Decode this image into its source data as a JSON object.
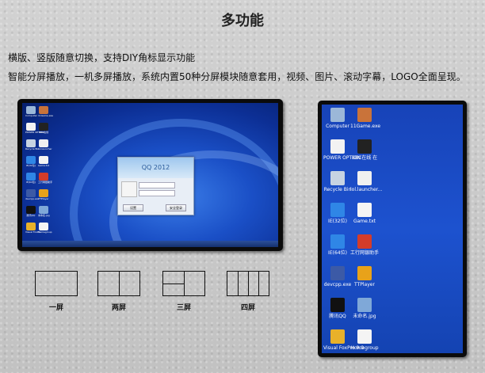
{
  "title": "多功能",
  "line1": "横版、竖版随意切换，支持DIY角标显示功能",
  "line2": "智能分屏播放，一机多屏播放，系统内置50种分屏模块随意套用，视频、图片、滚动字幕，LOGO全面呈现。",
  "horizontal_desktop": {
    "icons": [
      {
        "name": "computer-icon",
        "label": "Computer",
        "color": "#9bb7d8"
      },
      {
        "name": "game-icon",
        "label": "11Game.exe",
        "color": "#c9733a"
      },
      {
        "name": "power-icon",
        "label": "POWER OPTION",
        "color": "#f2f2f2"
      },
      {
        "name": "bbc-icon",
        "label": "BBC在线",
        "color": "#222"
      },
      {
        "name": "recycle-icon",
        "label": "Recycle Bin",
        "color": "#c7d3e2"
      },
      {
        "name": "lol-icon",
        "label": "lol.launcher",
        "color": "#f0f0f0"
      },
      {
        "name": "ie-icon",
        "label": "IE(32位)",
        "color": "#2f86e6"
      },
      {
        "name": "file-icon",
        "label": "Game.txt",
        "color": "#f4f4f4"
      },
      {
        "name": "ie64-icon",
        "label": "IE(64位)",
        "color": "#2f86e6"
      },
      {
        "name": "bank-icon",
        "label": "工行网银助手",
        "color": "#d43c2a"
      },
      {
        "name": "dev-icon",
        "label": "devcpp.exe",
        "color": "#3c5aa6"
      },
      {
        "name": "player-icon",
        "label": "TTPlayer",
        "color": "#e8a21a"
      },
      {
        "name": "qq-icon",
        "label": "腾讯QQ",
        "color": "#111"
      },
      {
        "name": "image-icon",
        "label": "未命名.jpg",
        "color": "#7fa8d8"
      },
      {
        "name": "foxpro-icon",
        "label": "Visual FoxPro",
        "color": "#e8b12a"
      },
      {
        "name": "homegroup-icon",
        "label": "Homegroup",
        "color": "#f4f4f4"
      }
    ],
    "qq_window": {
      "title": "QQ 2012",
      "login_button": "安全登录",
      "settings_button": "设置"
    }
  },
  "vertical_desktop": {
    "icons": [
      {
        "name": "computer-icon",
        "label": "Computer",
        "color": "#9bb7d8"
      },
      {
        "name": "game-icon",
        "label": "11Game.exe",
        "color": "#c9733a"
      },
      {
        "name": "power-icon",
        "label": "POWER OPTION",
        "color": "#f2f2f2"
      },
      {
        "name": "bbc-icon",
        "label": "BBC在线 在",
        "color": "#222"
      },
      {
        "name": "recycle-icon",
        "label": "Recycle Bin",
        "color": "#c7d3e2"
      },
      {
        "name": "lol-icon",
        "label": "lol.launcher...",
        "color": "#f0f0f0"
      },
      {
        "name": "ie-icon",
        "label": "IE(32位)",
        "color": "#2f86e6"
      },
      {
        "name": "file-icon",
        "label": "Game.txt",
        "color": "#f4f4f4"
      },
      {
        "name": "ie64-icon",
        "label": "IE(64位)",
        "color": "#2f86e6"
      },
      {
        "name": "bank-icon",
        "label": "工行网银助手",
        "color": "#d43c2a"
      },
      {
        "name": "dev-icon",
        "label": "devcpp.exe",
        "color": "#3c5aa6"
      },
      {
        "name": "player-icon",
        "label": "TTPlayer",
        "color": "#e8a21a"
      },
      {
        "name": "qq-icon",
        "label": "腾讯QQ",
        "color": "#111"
      },
      {
        "name": "image-icon",
        "label": "未命名.jpg",
        "color": "#7fa8d8"
      },
      {
        "name": "foxpro-icon",
        "label": "Visual FoxPro 9.0",
        "color": "#e8b12a"
      },
      {
        "name": "homegroup-icon",
        "label": "Homegroup",
        "color": "#f4f4f4"
      }
    ]
  },
  "layouts": [
    {
      "label": "一屏"
    },
    {
      "label": "两屏"
    },
    {
      "label": "三屏"
    },
    {
      "label": "四屏"
    }
  ]
}
